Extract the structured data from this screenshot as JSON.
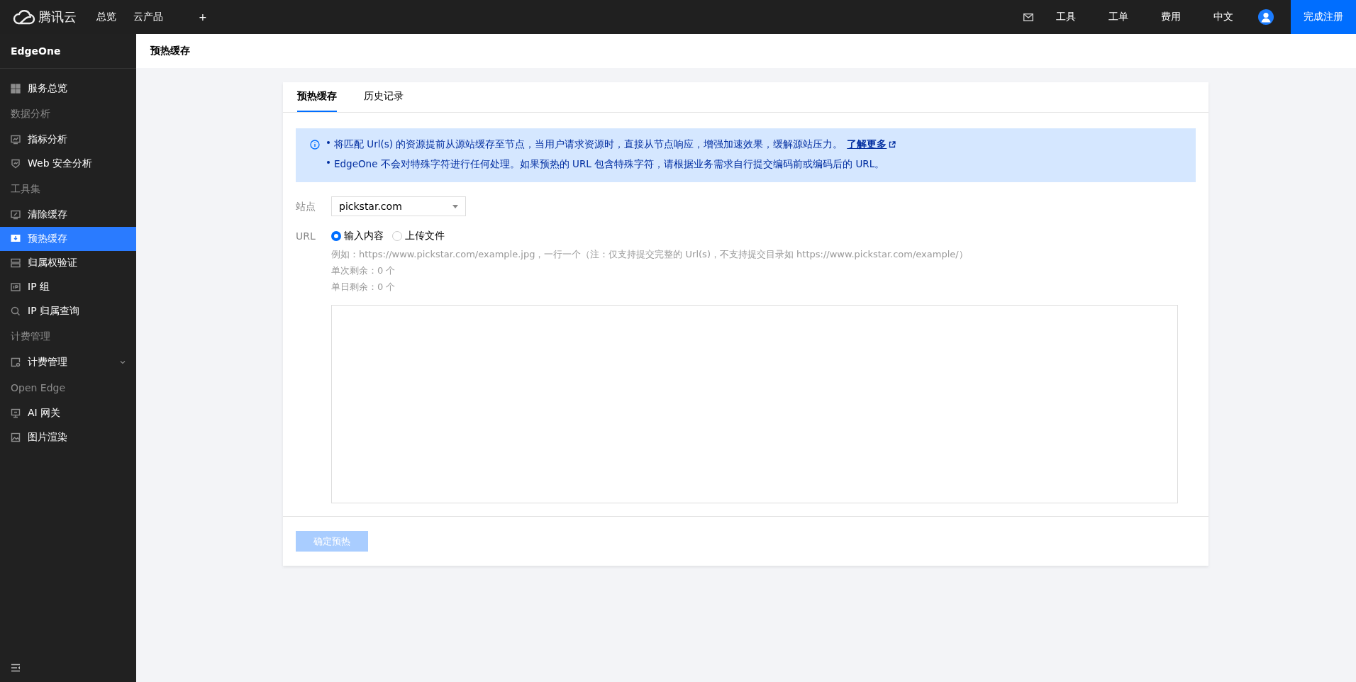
{
  "topbar": {
    "logo": "腾讯云",
    "nav": [
      "总览",
      "云产品",
      "+"
    ],
    "right": [
      "工具",
      "工单",
      "费用",
      "中文"
    ],
    "register": "完成注册"
  },
  "sidebar": {
    "title": "EdgeOne",
    "items": [
      {
        "kind": "item",
        "label": "服务总览",
        "selected": false
      },
      {
        "kind": "group",
        "label": "数据分析"
      },
      {
        "kind": "item",
        "label": "指标分析",
        "selected": false
      },
      {
        "kind": "item",
        "label": "Web 安全分析",
        "selected": false
      },
      {
        "kind": "group",
        "label": "工具集"
      },
      {
        "kind": "item",
        "label": "清除缓存",
        "selected": false
      },
      {
        "kind": "item",
        "label": "预热缓存",
        "selected": true
      },
      {
        "kind": "item",
        "label": "归属权验证",
        "selected": false
      },
      {
        "kind": "item",
        "label": "IP 组",
        "selected": false
      },
      {
        "kind": "item",
        "label": "IP 归属查询",
        "selected": false
      },
      {
        "kind": "group",
        "label": "计费管理"
      },
      {
        "kind": "item",
        "label": "计费管理",
        "selected": false,
        "expanded": false
      },
      {
        "kind": "group",
        "label": "Open Edge"
      },
      {
        "kind": "item",
        "label": "AI 网关",
        "selected": false
      },
      {
        "kind": "item",
        "label": "图片渲染",
        "selected": false
      }
    ]
  },
  "page": {
    "title": "预热缓存"
  },
  "tabs": [
    {
      "label": "预热缓存",
      "selected": true
    },
    {
      "label": "历史记录",
      "selected": false
    }
  ],
  "notice": [
    "将匹配 Url(s) 的资源提前从源站缓存至节点，当用户请求资源时，直接从节点响应，增强加速效果，缓解源站压力。",
    "EdgeOne 不会对特殊字符进行任何处理。如果预热的 URL 包含特殊字符，请根据业务需求自行提交编码前或编码后的 URL。"
  ],
  "notice_link": "了解更多",
  "form": {
    "site_label": "站点",
    "site_value": "pickstar.com",
    "url_label": "URL",
    "modes": [
      {
        "label": "输入内容",
        "selected": true
      },
      {
        "label": "上传文件",
        "selected": false
      }
    ],
    "hints": [
      "例如：https://www.pickstar.com/example.jpg，一行一个（注：仅支持提交完整的 Url(s)，不支持提交目录如 https://www.pickstar.com/example/）",
      "单次剩余：0 个",
      "单日剩余：0 个"
    ]
  },
  "submit": {
    "label": "确定预热",
    "disabled": true
  }
}
